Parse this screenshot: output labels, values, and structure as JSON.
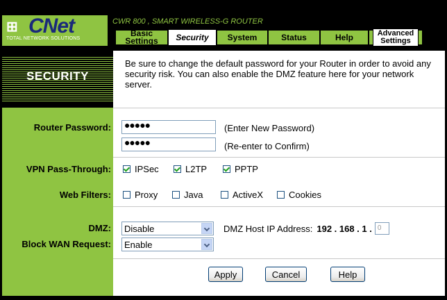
{
  "logo": {
    "mark": "⊞",
    "name": "CNet",
    "tagline": "TOTAL NETWORK SOLUTIONS"
  },
  "router_title": "CWR 800 , SMART WIRELESS-G ROUTER",
  "tabs": [
    {
      "label": "Basic Settings",
      "active": false
    },
    {
      "label": "Security",
      "active": true
    },
    {
      "label": "System",
      "active": false
    },
    {
      "label": "Status",
      "active": false
    },
    {
      "label": "Help",
      "active": false
    },
    {
      "label": "Advanced Settings",
      "active": false
    }
  ],
  "section_title": "SECURITY",
  "intro": "Be sure to change the default password for your Router in order to avoid any security risk. You can also enable the DMZ feature here for your network server.",
  "labels": {
    "router_password": "Router Password:",
    "vpn": "VPN Pass-Through:",
    "web_filters": "Web Filters:",
    "dmz": "DMZ:",
    "block_wan": "Block WAN Request:"
  },
  "password": {
    "value1": "●●●●●",
    "note1": "(Enter New Password)",
    "value2": "●●●●●",
    "note2": "(Re-enter to Confirm)"
  },
  "vpn": [
    {
      "label": "IPSec",
      "checked": true
    },
    {
      "label": "L2TP",
      "checked": true
    },
    {
      "label": "PPTP",
      "checked": true
    }
  ],
  "web_filters": [
    {
      "label": "Proxy",
      "checked": false
    },
    {
      "label": "Java",
      "checked": false
    },
    {
      "label": "ActiveX",
      "checked": false
    },
    {
      "label": "Cookies",
      "checked": false
    }
  ],
  "dmz": {
    "value": "Disable",
    "host_label": "DMZ Host IP Address:",
    "ip_prefix": "192 . 168 . 1 .",
    "last_octet": "0"
  },
  "block_wan": {
    "value": "Enable"
  },
  "buttons": {
    "apply": "Apply",
    "cancel": "Cancel",
    "help": "Help"
  },
  "colors": {
    "green": "#8fc442",
    "navy": "#1a2a7a"
  }
}
